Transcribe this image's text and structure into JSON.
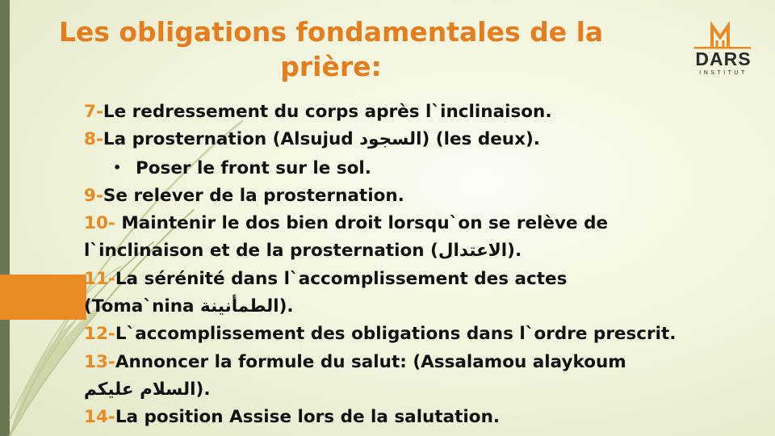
{
  "title": "Les obligations fondamentales de la prière:",
  "logo": {
    "name": "DARS",
    "subtitle": "INSTITUT"
  },
  "colors": {
    "accent": "#ea8a22",
    "sidebar": "#68774f",
    "text": "#111111"
  },
  "items": [
    {
      "num": "7-",
      "text": "Le redressement du corps après l`inclinaison."
    },
    {
      "num": "8-",
      "text": "La prosternation (Alsujud السجود) (les deux)."
    },
    {
      "bullet": "•",
      "text": "Poser le front sur le sol."
    },
    {
      "num": "9-",
      "text": "Se relever de la prosternation."
    },
    {
      "num": "10-",
      "text": " Maintenir le dos bien droit lorsqu`on se relève de"
    },
    {
      "text": "l`inclinaison et de la prosternation (الاعتدال)."
    },
    {
      "num": "11-",
      "text": "La sérénité dans l`accomplissement des actes"
    },
    {
      "text": "(Toma`nina الطمأنينة)."
    },
    {
      "num": "12-",
      "text": "L`accomplissement des obligations dans l`ordre prescrit."
    },
    {
      "num": "13-",
      "text": "Annoncer la formule du salut: (Assalamou alaykoum"
    },
    {
      "text": "السلام عليكم)."
    },
    {
      "num": "14-",
      "text": "La position Assise lors de la salutation."
    }
  ]
}
